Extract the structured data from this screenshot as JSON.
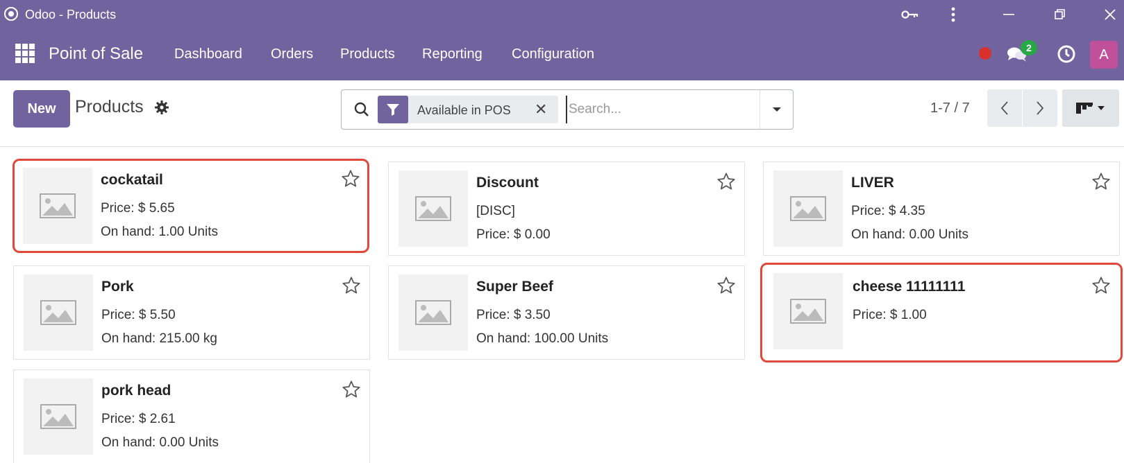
{
  "window": {
    "title": "Odoo - Products"
  },
  "navbar": {
    "brand": "Point of Sale",
    "menu": [
      "Dashboard",
      "Orders",
      "Products",
      "Reporting",
      "Configuration"
    ],
    "chat_badge": "2",
    "avatar_letter": "A"
  },
  "control": {
    "new_label": "New",
    "breadcrumb": "Products",
    "facet_label": "Available in POS",
    "facet_remove": "✕",
    "search_placeholder": "Search...",
    "pager": "1-7 / 7"
  },
  "products": [
    {
      "name": "cockatail",
      "line1": "Price: $ 5.65",
      "line2": "On hand: 1.00 Units"
    },
    {
      "name": "Discount",
      "line1": "[DISC]",
      "line2": "Price: $ 0.00"
    },
    {
      "name": "LIVER",
      "line1": "Price: $ 4.35",
      "line2": "On hand: 0.00 Units"
    },
    {
      "name": "Pork",
      "line1": "Price: $ 5.50",
      "line2": "On hand: 215.00 kg"
    },
    {
      "name": "Super Beef",
      "line1": "Price: $ 3.50",
      "line2": "On hand: 100.00 Units"
    },
    {
      "name": "cheese 11111111",
      "line1": "Price: $ 1.00",
      "line2": ""
    },
    {
      "name": "pork head",
      "line1": "Price: $ 2.61",
      "line2": "On hand: 0.00 Units"
    }
  ],
  "colors": {
    "brand": "#71639e",
    "highlight": "#e0493a",
    "badge": "#28a745",
    "avatar": "#c0509a",
    "record_dot": "#d9302c"
  }
}
